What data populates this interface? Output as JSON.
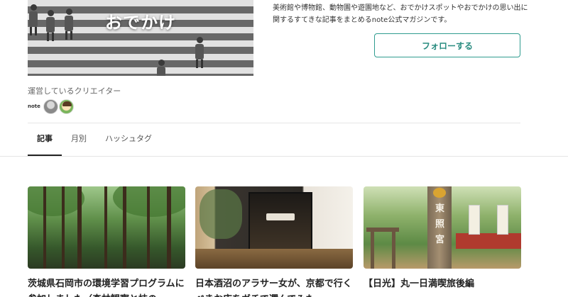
{
  "magazine": {
    "cover_title": "おでかけ",
    "description": "美術館や博物館、動物園や遊園地など、おでかけスポットやおでかけの思い出に関するすてきな記事をまとめるnote公式マガジンです。",
    "follow_label": "フォローする"
  },
  "creators": {
    "label": "運営しているクリエイター",
    "logo_text": "note"
  },
  "tabs": [
    {
      "label": "記事",
      "active": true
    },
    {
      "label": "月別",
      "active": false
    },
    {
      "label": "ハッシュタグ",
      "active": false
    }
  ],
  "cards": [
    {
      "title": "茨城県石岡市の環境学習プログラムに参加しました（森林観察と枝の",
      "thumb": "forest"
    },
    {
      "title": "日本酒沼のアラサー女が、京都で行くべきお店をガチで選んでみた",
      "thumb": "shop"
    },
    {
      "title": "【日光】丸一日満喫旅後編",
      "thumb": "temple"
    }
  ],
  "temple_sign": [
    "東",
    "照",
    "宮"
  ],
  "colors": {
    "accent": "#2a8c80",
    "text": "#222222",
    "divider": "#e4e4e4"
  }
}
